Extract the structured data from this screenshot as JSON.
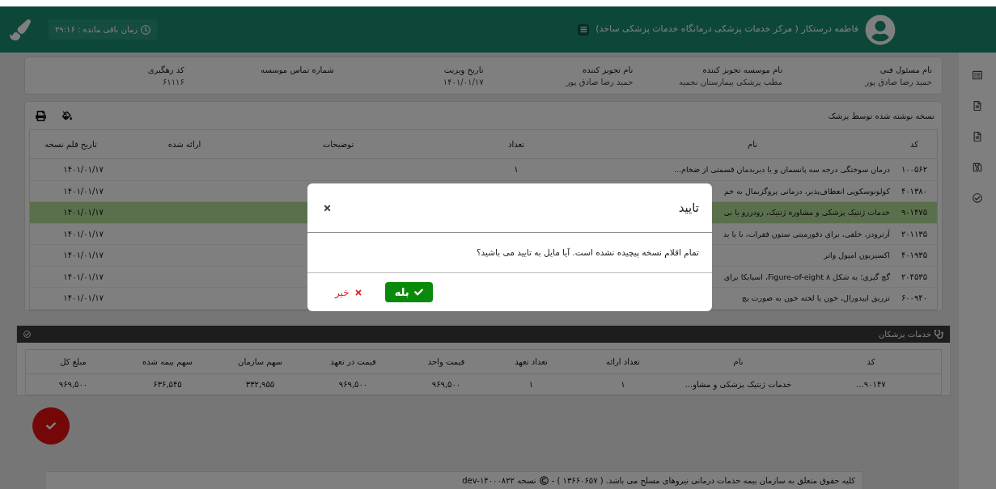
{
  "header": {
    "user_name": "فاطمه درستکار ( مرکز خدمات پزشکی درمانگاه خدمات پزشکی ساخد)",
    "timer": "زمان باقی مانده : ۲۹:۱۶"
  },
  "info": [
    {
      "label": "نام مسئول فنی",
      "value": "حمید رضا صادق پور"
    },
    {
      "label": "نام موسسه تجویز کننده",
      "value": "مطب پزشکی بیمارستان نجمیه"
    },
    {
      "label": "نام تجویز کننده",
      "value": "حمید رضا صادق پور"
    },
    {
      "label": "تاریخ ویزیت",
      "value": "۱۴۰۱/۰۱/۱۷"
    },
    {
      "label": "شماره تماس موسسه"
    },
    {
      "label": "کد رهگیری",
      "value": "۶۱۱۱۶"
    }
  ],
  "prescription": {
    "title": "نسخه نوشته شده توسط پزشک",
    "columns": [
      "کد",
      "نام",
      "تعداد",
      "توضیحات",
      "ارائه شده",
      "تاریخ قلم نسخه"
    ],
    "rows": [
      {
        "selected": false,
        "code": "۱۰۰۵۶۲",
        "name": "درمان سوختگی درجه سه پانسمان و یا دبریدمان قسمتی از ضخام...",
        "count": "۱",
        "date": "۱۴۰۱/۰۱/۱۷"
      },
      {
        "selected": false,
        "code": "۴۰۱۳۸۰",
        "name": "کولونوسکوپی انعطاف‌پذیر، درمانی پروگزیمال به خم",
        "date": "۱۴۰۱/۰۱/۱۷"
      },
      {
        "selected": true,
        "code": "۹۰۱۴۷۵",
        "name": "خدمات ژنتیک پزشکی و مشاوره ژنتیک، رودررو یا بی",
        "date": "۱۴۰۱/۰۱/۱۷"
      },
      {
        "selected": false,
        "code": "۲۰۱۱۳۵",
        "name": "آرترودز، خلفی، برای دفورمیتی ستون فقرات، با یا بد",
        "date": "۱۴۰۱/۰۱/۱۷"
      },
      {
        "selected": false,
        "code": "۴۰۱۹۳۵",
        "name": "اکسیزیون امپول واتر",
        "date": "۱۴۰۱/۰۱/۱۷"
      },
      {
        "selected": false,
        "code": "۲۰۴۵۳۵",
        "name": "گچ گیری؛ به شکل ۸ Figure-of-eight، اسپایکا برای",
        "date": "۱۴۰۱/۰۱/۱۷"
      },
      {
        "selected": false,
        "code": "۶۰۰۹۴۰",
        "name": "تزریق اپیدورال، خون یا لخته خون به صورت پچ",
        "date": "۱۴۰۱/۰۱/۱۷"
      }
    ]
  },
  "services": {
    "title": "خدمات پزشکان",
    "columns": [
      "کد",
      "نام",
      "تعداد ارائه",
      "تعداد تعهد",
      "قیمت واحد",
      "قیمت در تعهد",
      "سهم سازمان",
      "سهم بیمه شده",
      "مبلغ کل"
    ],
    "rows": [
      [
        "۹۰۱۴۷...",
        "خدمات ژنتیک پزشکی و مشاو...",
        "۱",
        "۱",
        "۹۶۹,۵۰۰",
        "۹۶۹,۵۰۰",
        "۳۳۲,۹۵۵",
        "۶۳۶,۵۴۵",
        "۹۶۹,۵۰۰"
      ]
    ]
  },
  "footer": {
    "text": "کلیه حقوق متعلق به سازمان بیمه خدمات درمانی نیروهای مسلح می باشد. ( ۱۳۶۶۰۶۵۷ ) -",
    "version": "نسخه dev-۱۴۰۰۰۸۲۲"
  },
  "dialog": {
    "title": "تایید",
    "message": "تمام اقلام نسخه پیچیده نشده است. آیا مایل به تایید می باشید؟",
    "buttons": [
      {
        "kind": "confirm",
        "label": "بله"
      },
      {
        "kind": "cancel",
        "label": "خیر"
      }
    ]
  }
}
